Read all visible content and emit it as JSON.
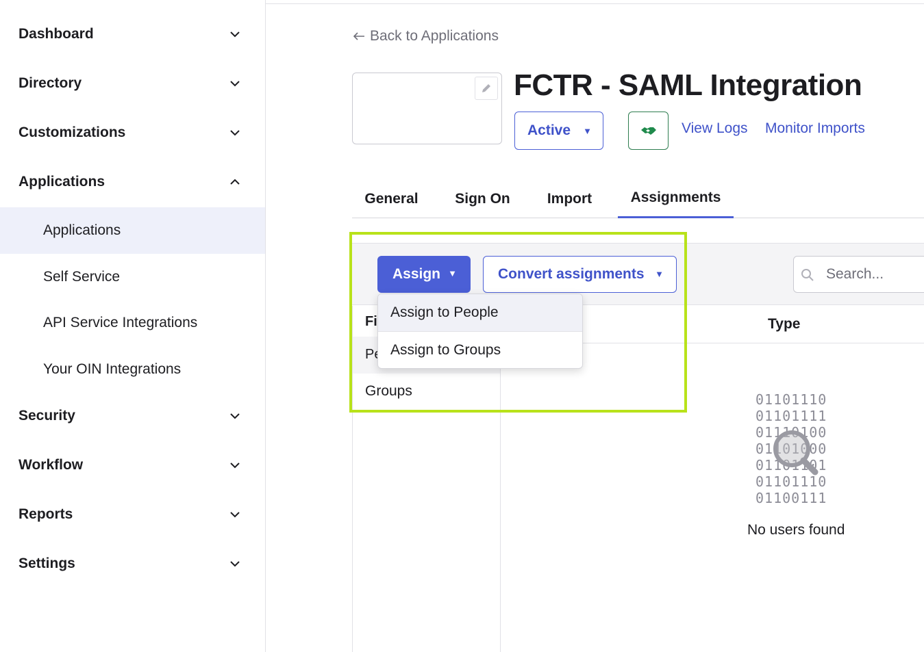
{
  "sidebar": {
    "items": [
      {
        "label": "Dashboard",
        "icon": "chevron-down-icon"
      },
      {
        "label": "Directory",
        "icon": "chevron-down-icon"
      },
      {
        "label": "Customizations",
        "icon": "chevron-down-icon"
      },
      {
        "label": "Applications",
        "icon": "chevron-up-icon",
        "expanded": true
      },
      {
        "label": "Security",
        "icon": "chevron-down-icon"
      },
      {
        "label": "Workflow",
        "icon": "chevron-down-icon"
      },
      {
        "label": "Reports",
        "icon": "chevron-down-icon"
      },
      {
        "label": "Settings",
        "icon": "chevron-down-icon"
      }
    ],
    "subitems": [
      {
        "label": "Applications",
        "active": true
      },
      {
        "label": "Self Service"
      },
      {
        "label": "API Service Integrations"
      },
      {
        "label": "Your OIN Integrations"
      }
    ]
  },
  "header": {
    "back_label": "Back to Applications",
    "app_title": "FCTR - SAML Integration",
    "status_label": "Active",
    "view_logs": "View Logs",
    "monitor_imports": "Monitor Imports"
  },
  "tabs": [
    {
      "label": "General"
    },
    {
      "label": "Sign On"
    },
    {
      "label": "Import"
    },
    {
      "label": "Assignments",
      "active": true
    }
  ],
  "assignments": {
    "assign_label": "Assign",
    "convert_label": "Convert assignments",
    "search_placeholder": "Search...",
    "filter_head": "Fil",
    "filter_people": "Pe",
    "filter_groups": "Groups",
    "type_column": "Type",
    "binary_lines": [
      "01101110",
      "01101111",
      "01110100",
      "01101000",
      "01101101",
      "01101110",
      "01100111"
    ],
    "empty_text": "No users found"
  },
  "menu": {
    "items": [
      "Assign to People",
      "Assign to Groups"
    ]
  },
  "colors": {
    "accent": "#4b5fd6",
    "highlight": "#b8e21a",
    "active_bg": "#eef0fa"
  }
}
